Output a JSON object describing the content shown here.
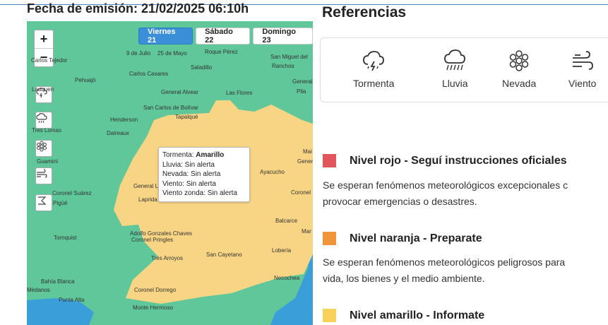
{
  "emission": "Fecha de emisión: 21/02/2025 06:10h",
  "days": [
    {
      "label": "Viernes 21",
      "active": true
    },
    {
      "label": "Sábado 22",
      "active": false
    },
    {
      "label": "Domingo 23",
      "active": false
    }
  ],
  "zoom": {
    "in": "+",
    "out": "−"
  },
  "map_labels": {
    "carlos_tejedor": "Carlos Tejedor",
    "nueve_julio": "9 de Julio",
    "veinticinco_mayo": "25 de Mayo",
    "roque_perez": "Roque Pérez",
    "san_miguel": "San Miguel del",
    "ranchos": "Ranchos",
    "saladillo": "Saladillo",
    "pehuajo": "Pehuajó",
    "carlos_casares": "Carlos Casares",
    "lauquen": "Lauquen",
    "general_alvear": "General Alvear",
    "las_flores": "Las Flores",
    "general_b": "General B",
    "pila": "Pila",
    "san_carlos": "San Carlos de Bolívar",
    "tapalque": "Tapalqué",
    "henderson": "Henderson",
    "tres_lomas": "Tres Lomas",
    "daireaux": "Daireaux",
    "mai": "Mai",
    "guamini": "Guaminí",
    "ayacucho": "Ayacucho",
    "genera": "Genera",
    "general_la": "General La",
    "coronel_suarez": "Coronel Suárez",
    "pigue": "Pigüé",
    "laprida": "Laprida",
    "coronel": "Coronel",
    "balcarce": "Balcarce",
    "mar": "Mar",
    "tornquist": "Tornquist",
    "adolfo_gonzales": "Adolfo Gonzales Chaves",
    "coronel_pringles": "Coronel Pringles",
    "loberia": "Lobería",
    "tres_arroyos": "Tres Arroyos",
    "san_cayetano": "San Cayetano",
    "necochea": "Necochea",
    "bahia_blanca": "Bahía Blanca",
    "medanos": "Médanos",
    "punta_alta": "Punta Alta",
    "coronel_dorrego": "Coronel Dorrego",
    "monte_hermoso": "Monte Hermoso"
  },
  "tooltip": {
    "tormenta_label": "Tormenta:",
    "tormenta_value": "Amarillo",
    "lluvia": "Lluvia: Sin alerta",
    "nevada": "Nevada: Sin alerta",
    "viento": "Viento: Sin alerta",
    "viento_zonda": "Viento zonda: Sin alerta"
  },
  "references": {
    "title": "Referencias",
    "items": [
      {
        "label": "Tormenta",
        "icon": "storm-icon"
      },
      {
        "label": "Lluvia",
        "icon": "rain-icon"
      },
      {
        "label": "Nevada",
        "icon": "snow-icon"
      },
      {
        "label": "Viento",
        "icon": "wind-icon"
      }
    ]
  },
  "levels": [
    {
      "title": "Nivel rojo - Seguí instrucciones oficiales",
      "color": "#e0565b",
      "desc1": "Se esperan fenómenos meteorológicos excepcionales c",
      "desc2": "provocar emergencias o desastres."
    },
    {
      "title": "Nivel naranja - Preparate",
      "color": "#f0953a",
      "desc1": "Se esperan fenómenos meteorológicos peligrosos para",
      "desc2": "vida, los bienes y el medio ambiente."
    },
    {
      "title": "Nivel amarillo - Informate",
      "color": "#f8d25a"
    }
  ],
  "colors": {
    "green_zone": "#5fc79a",
    "yellow_zone": "#f8d584",
    "sea": "#3a9fd8"
  }
}
